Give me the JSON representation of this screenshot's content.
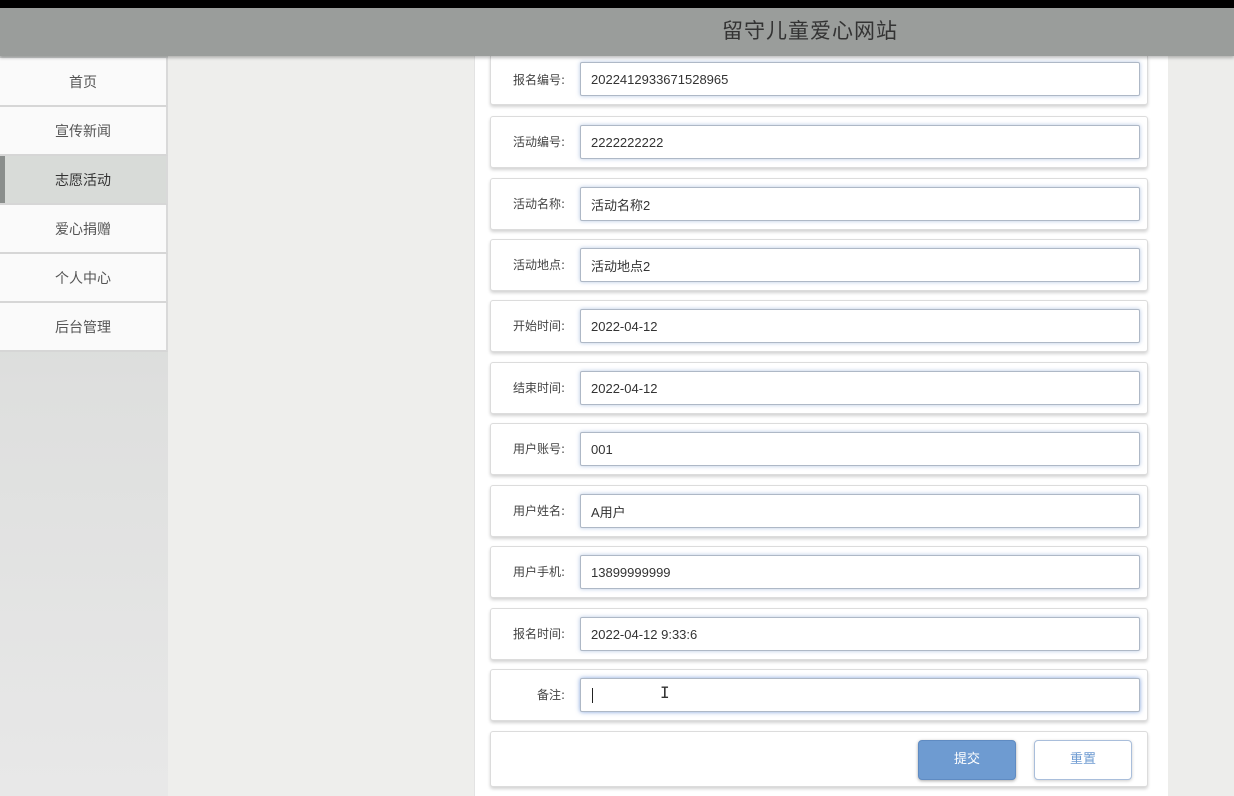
{
  "header": {
    "site_title": "留守儿童爱心网站"
  },
  "sidebar": {
    "items": [
      {
        "label": "首页"
      },
      {
        "label": "宣传新闻"
      },
      {
        "label": "志愿活动"
      },
      {
        "label": "爱心捐赠"
      },
      {
        "label": "个人中心"
      },
      {
        "label": "后台管理"
      }
    ],
    "active_index": 2
  },
  "form": {
    "fields": [
      {
        "label": "报名编号:",
        "value": "2022412933671528965"
      },
      {
        "label": "活动编号:",
        "value": "2222222222"
      },
      {
        "label": "活动名称:",
        "value": "活动名称2"
      },
      {
        "label": "活动地点:",
        "value": "活动地点2"
      },
      {
        "label": "开始时间:",
        "value": "2022-04-12"
      },
      {
        "label": "结束时间:",
        "value": "2022-04-12"
      },
      {
        "label": "用户账号:",
        "value": "001"
      },
      {
        "label": "用户姓名:",
        "value": "A用户"
      },
      {
        "label": "用户手机:",
        "value": "13899999999"
      },
      {
        "label": "报名时间:",
        "value": "2022-04-12 9:33:6"
      },
      {
        "label": "备注:",
        "value": ""
      }
    ]
  },
  "actions": {
    "submit_label": "提交",
    "reset_label": "重置"
  },
  "colors": {
    "header_bg": "#9a9d9b",
    "submit_bg": "#6e9bd1",
    "active_nav_bg": "#d8dbd8"
  }
}
